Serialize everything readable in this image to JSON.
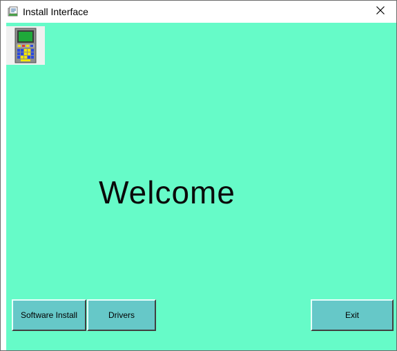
{
  "window": {
    "title": "Install Interface",
    "close_glyph": "✕"
  },
  "icons": {
    "app": "installer-app-icon",
    "logo": "handheld-device-icon",
    "close": "close-icon"
  },
  "main": {
    "welcome_text": "Welcome"
  },
  "buttons": {
    "software_install": "Software Install",
    "drivers": "Drivers",
    "exit": "Exit"
  },
  "colors": {
    "background": "#66fbc8",
    "button_face": "#66c8c8"
  }
}
